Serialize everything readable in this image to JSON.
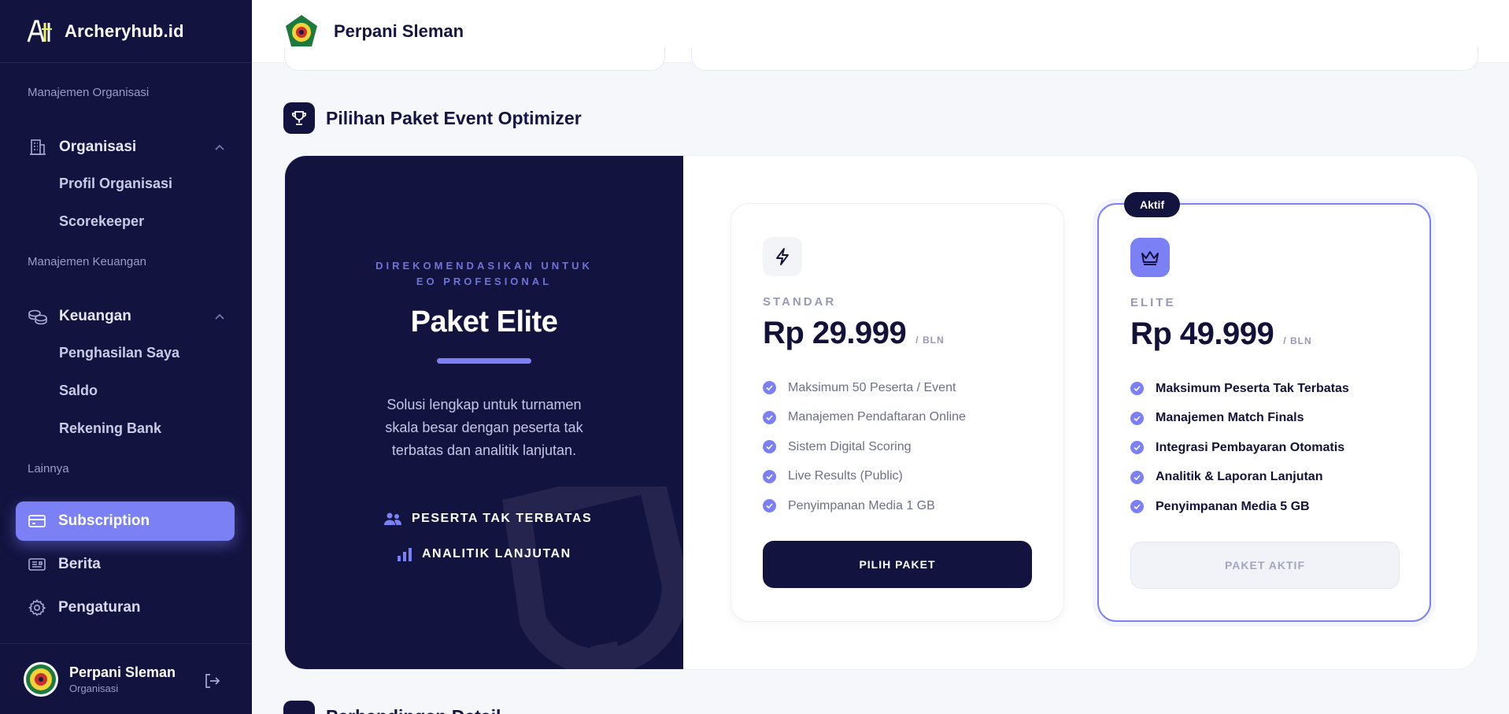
{
  "app": {
    "brand": "Archeryhub.id"
  },
  "sidebar": {
    "sections": {
      "org_management": "Manajemen Organisasi",
      "finance_management": "Manajemen Keuangan",
      "others": "Lainnya"
    },
    "organisasi": {
      "label": "Organisasi",
      "children": [
        "Profil Organisasi",
        "Scorekeeper"
      ]
    },
    "keuangan": {
      "label": "Keuangan",
      "children": [
        "Penghasilan Saya",
        "Saldo",
        "Rekening Bank"
      ]
    },
    "items": {
      "subscription": "Subscription",
      "berita": "Berita",
      "pengaturan": "Pengaturan"
    },
    "user": {
      "name": "Perpani Sleman",
      "role": "Organisasi"
    }
  },
  "topbar": {
    "title": "Perpani Sleman"
  },
  "section": {
    "title": "Pilihan Paket Event Optimizer"
  },
  "featured": {
    "recommendation": "DIREKOMENDASIKAN UNTUK EO PROFESIONAL",
    "title": "Paket Elite",
    "description": "Solusi lengkap untuk turnamen skala besar dengan peserta tak terbatas dan analitik lanjutan.",
    "perks": [
      "PESERTA TAK TERBATAS",
      "ANALITIK LANJUTAN"
    ]
  },
  "plans": {
    "standard": {
      "name": "STANDAR",
      "price": "Rp 29.999",
      "period": "/ BLN",
      "features": [
        "Maksimum 50 Peserta / Event",
        "Manajemen Pendaftaran Online",
        "Sistem Digital Scoring",
        "Live Results (Public)",
        "Penyimpanan Media 1 GB"
      ],
      "button": "PILIH PAKET"
    },
    "elite": {
      "badge": "Aktif",
      "name": "ELITE",
      "price": "Rp 49.999",
      "period": "/ BLN",
      "features": [
        "Maksimum Peserta Tak Terbatas",
        "Manajemen Match Finals",
        "Integrasi Pembayaran Otomatis",
        "Analitik & Laporan Lanjutan",
        "Penyimpanan Media 5 GB"
      ],
      "button": "PAKET AKTIF"
    }
  },
  "next_section": {
    "title": "Perbandingan Detail"
  },
  "colors": {
    "sidebar": "#131340",
    "accent": "#7b80f5",
    "background": "#f6f7fb"
  }
}
